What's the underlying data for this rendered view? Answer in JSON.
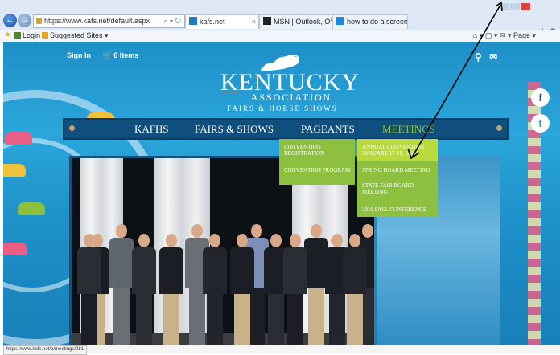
{
  "browser": {
    "url": "https://www.kafs.net/default.aspx",
    "tabs": [
      {
        "label": "kafs.net",
        "active": true
      },
      {
        "label": "MSN | Outlook, Office, S...",
        "active": false
      },
      {
        "label": "how to do a screenshot ...",
        "active": false
      }
    ],
    "favorites": {
      "login": "Login",
      "suggested": "Suggested Sites ▾"
    },
    "tools": "Page ▾",
    "status_url": "https://www.kafs.net/p/meetings/281"
  },
  "site": {
    "sign_in": "Sign In",
    "cart": "0 Items",
    "logo": {
      "title": "KENTUCKY",
      "subtitle": "ASSOCIATION",
      "tagline": "FAIRS & HORSE SHOWS"
    },
    "social": {
      "facebook": "f",
      "twitter": "t"
    },
    "nav": [
      "KAFHS",
      "FAIRS & SHOWS",
      "PAGEANTS",
      "MEETINGS"
    ],
    "active_nav": "MEETINGS",
    "dropdown_left": [
      "CONVENTION REGISTRATION",
      "CONVENTION PROGRAM"
    ],
    "dropdown_right": [
      "ANNUAL CONVENTION JANUARY 17-19, 2019",
      "SPRING BOARD MEETING",
      "STATE FAIR BOARD MEETING",
      "2019 FALL CONFERENCE"
    ]
  },
  "colors": {
    "accent_green": "#8dc03f",
    "highlight_green": "#b9da3a",
    "nav_blue": "#0f4f7d",
    "page_blue": "#2aa6db"
  }
}
